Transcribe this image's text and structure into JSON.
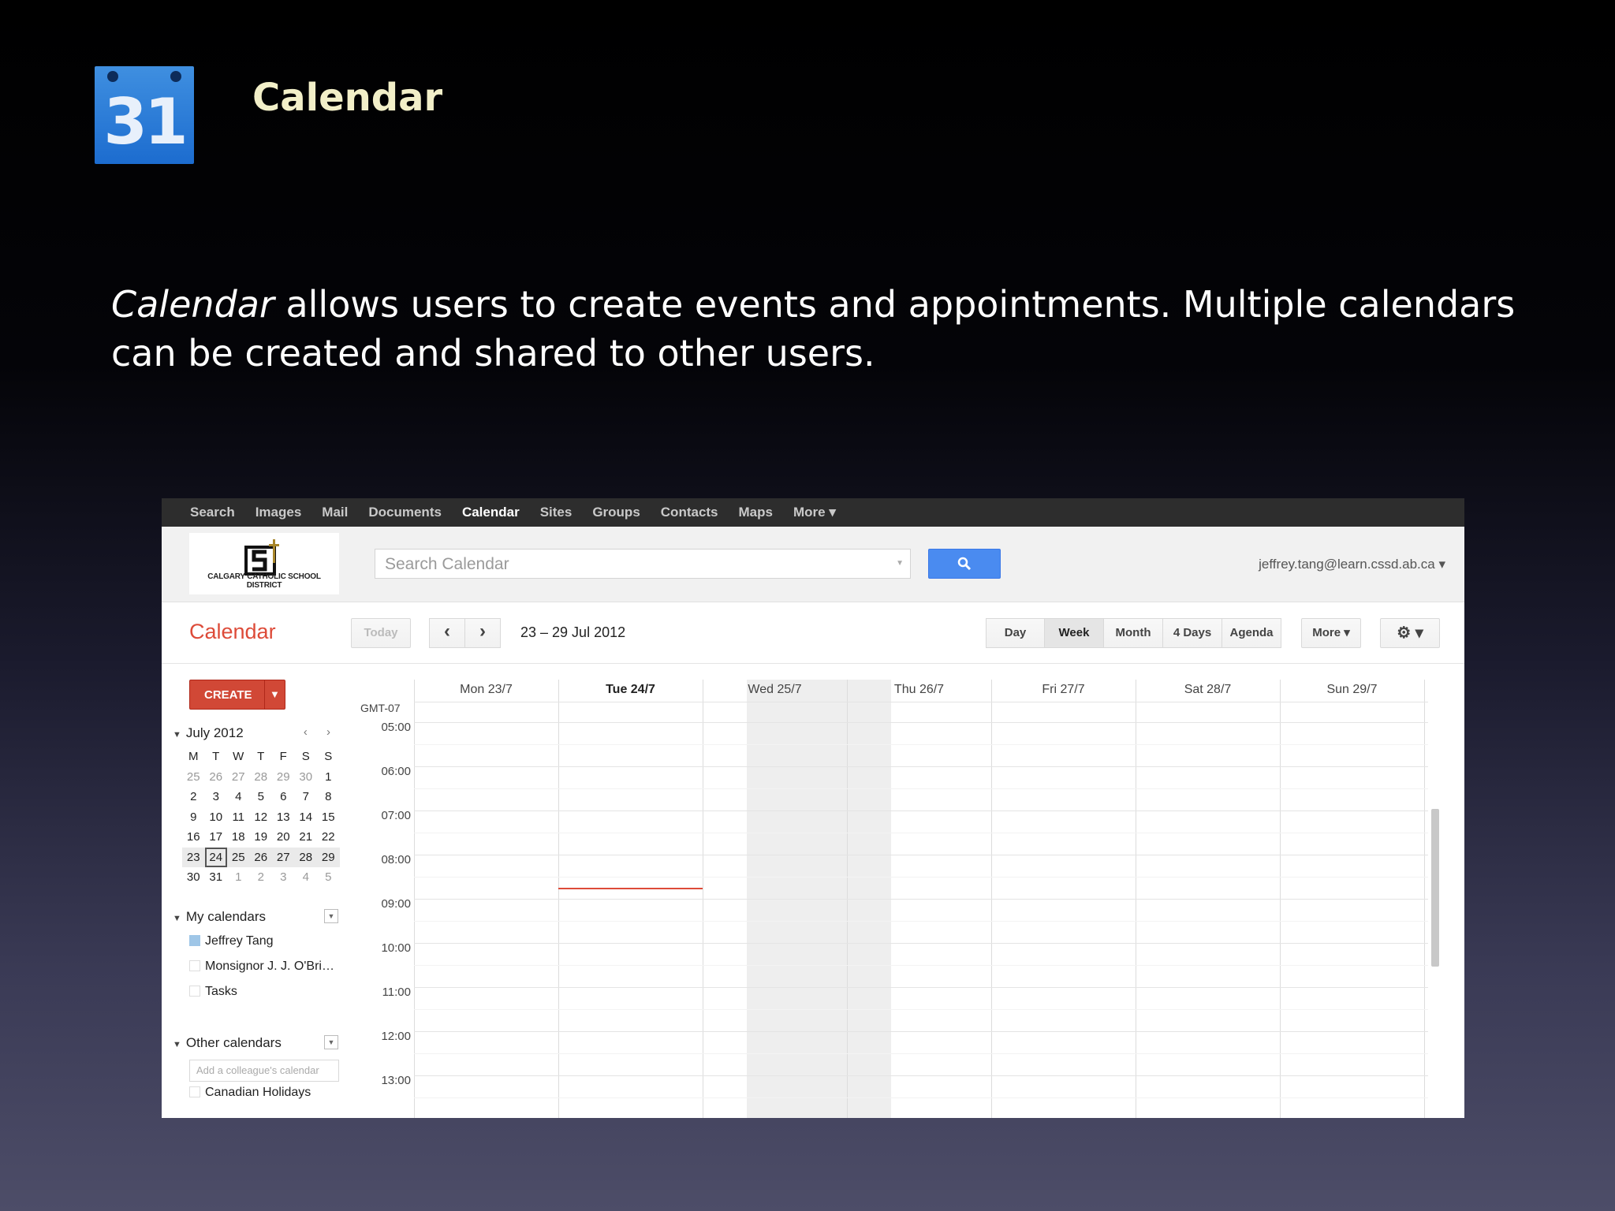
{
  "slide": {
    "icon_number": "31",
    "title": "Calendar",
    "body_emph": "Calendar",
    "body_rest": " allows users to create events and appointments.  Multiple calendars can be created and shared to other users."
  },
  "gbar": {
    "items": [
      "Search",
      "Images",
      "Mail",
      "Documents",
      "Calendar",
      "Sites",
      "Groups",
      "Contacts",
      "Maps",
      "More ▾"
    ],
    "active": "Calendar"
  },
  "header": {
    "school_caption": "CALGARY CATHOLIC SCHOOL DISTRICT",
    "search_placeholder": "Search Calendar",
    "user_email": "jeffrey.tang@learn.cssd.ab.ca ▾"
  },
  "toolbar": {
    "app_name": "Calendar",
    "today": "Today",
    "prev": "‹",
    "next": "›",
    "date_range": "23 – 29 Jul 2012",
    "views": [
      "Day",
      "Week",
      "Month",
      "4 Days",
      "Agenda"
    ],
    "active_view": "Week",
    "more": "More ▾",
    "settings": "⚙ ▾"
  },
  "sidebar": {
    "create_label": "CREATE",
    "create_arrow": "▼",
    "mini_month": "July 2012",
    "mini_nav": "‹ ›",
    "dow": [
      "M",
      "T",
      "W",
      "T",
      "F",
      "S",
      "S"
    ],
    "weeks": [
      [
        "25",
        "26",
        "27",
        "28",
        "29",
        "30",
        "1"
      ],
      [
        "2",
        "3",
        "4",
        "5",
        "6",
        "7",
        "8"
      ],
      [
        "9",
        "10",
        "11",
        "12",
        "13",
        "14",
        "15"
      ],
      [
        "16",
        "17",
        "18",
        "19",
        "20",
        "21",
        "22"
      ],
      [
        "23",
        "24",
        "25",
        "26",
        "27",
        "28",
        "29"
      ],
      [
        "30",
        "31",
        "1",
        "2",
        "3",
        "4",
        "5"
      ]
    ],
    "today_date": "24",
    "my_calendars_label": "My calendars",
    "my_calendars": [
      {
        "name": "Jeffrey Tang",
        "checked": true
      },
      {
        "name": "Monsignor J. J. O'Bri…",
        "checked": false
      },
      {
        "name": "Tasks",
        "checked": false
      }
    ],
    "other_calendars_label": "Other calendars",
    "colleague_placeholder": "Add a colleague's calendar",
    "other_calendars": [
      {
        "name": "Canadian Holidays",
        "checked": false
      }
    ]
  },
  "grid": {
    "timezone": "GMT-07",
    "days": [
      "Mon 23/7",
      "Tue 24/7",
      "Wed 25/7",
      "Thu 26/7",
      "Fri 27/7",
      "Sat 28/7",
      "Sun 29/7"
    ],
    "today_day": "Tue 24/7",
    "times": [
      "05:00",
      "06:00",
      "07:00",
      "08:00",
      "09:00",
      "10:00",
      "11:00",
      "12:00",
      "13:00"
    ]
  },
  "colors": {
    "accent_red": "#dd4b39",
    "search_blue": "#4a8bf0",
    "slide_title": "#f2efc8"
  }
}
